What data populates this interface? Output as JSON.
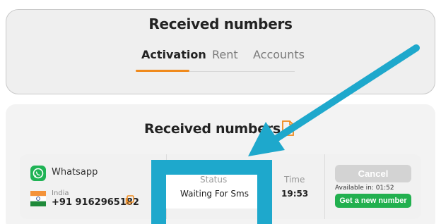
{
  "header": {
    "title": "Received numbers",
    "tabs": [
      {
        "label": "Activation",
        "active": true
      },
      {
        "label": "Rent",
        "active": false
      },
      {
        "label": "Accounts",
        "active": false
      }
    ]
  },
  "panel": {
    "title": "Received numbers",
    "row": {
      "service": "Whatsapp",
      "country": "India",
      "phone": "+91 9162965182",
      "status_label": "Status",
      "status_value": "Waiting For Sms",
      "time_label": "Time",
      "time_value": "19:53",
      "cancel_label": "Cancel",
      "available": "Available in: 01:52",
      "new_number_label": "Get a new number"
    }
  },
  "colors": {
    "accent_orange": "#f08a1c",
    "highlight_blue": "#1ea8cc",
    "green": "#22b04f",
    "whatsapp_green": "#1fb355"
  }
}
